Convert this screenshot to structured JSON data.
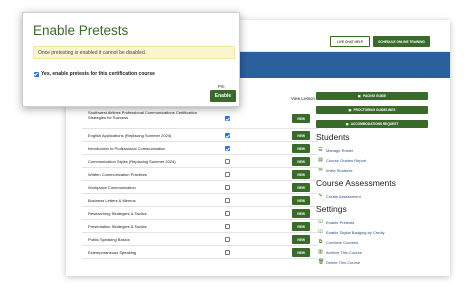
{
  "header": {
    "live_chat_label": "LIVE CHAT HELP",
    "schedule_label": "SCHEDULE ONLINE TRAINING"
  },
  "table": {
    "view_header": "View Lesson",
    "view_label": "VIEW",
    "rows": [
      {
        "title": "Southwest Airlines Professional Communications Certification Strategies for Success",
        "pretest": true
      },
      {
        "title": "English Applications (Replacing Summer 2024)",
        "pretest": true
      },
      {
        "title": "Introduction to Professional Communication",
        "pretest": true
      },
      {
        "title": "Communication Styles (Replacing Summer 2024)",
        "pretest": false
      },
      {
        "title": "Written Communication Practices",
        "pretest": false
      },
      {
        "title": "Workplace Communication",
        "pretest": false
      },
      {
        "title": "Business Letters & Memos",
        "pretest": false
      },
      {
        "title": "Researching Strategies & Tactics",
        "pretest": false
      },
      {
        "title": "Presentation Strategies & Tactics",
        "pretest": false
      },
      {
        "title": "Public Speaking Basics",
        "pretest": false
      },
      {
        "title": "Extemporaneous Speaking",
        "pretest": false
      }
    ]
  },
  "sidebar": {
    "buttons": [
      "PACING GUIDE",
      "PROCTORING GUIDELINES",
      "ACCOMMODATIONS REQUEST"
    ],
    "students_heading": "Students",
    "students_links": [
      "Manage Roster",
      "Course Grades Report",
      "Invite Students"
    ],
    "assessments_heading": "Course Assessments",
    "assessments_links": [
      "Create Assessment"
    ],
    "settings_heading": "Settings",
    "settings_links": [
      "Enable Pretests",
      "Enable Digital Badging by Credly",
      "Combine Courses",
      "Archive This Course",
      "Delete This Course"
    ]
  },
  "modal": {
    "title": "Enable Pretests",
    "alert": "Once pretesting is enabled it cannot be disabled.",
    "checkbox_label": "Yes, enable pretests for this certification course",
    "checkbox_checked": true,
    "submit_label": "Enable",
    "partial_header": "Pre"
  },
  "colors": {
    "brand_green": "#3a6a2a",
    "header_blue": "#2c5f9e",
    "alert_bg": "#fbf5cf",
    "checkbox_blue": "#2a73d9"
  }
}
